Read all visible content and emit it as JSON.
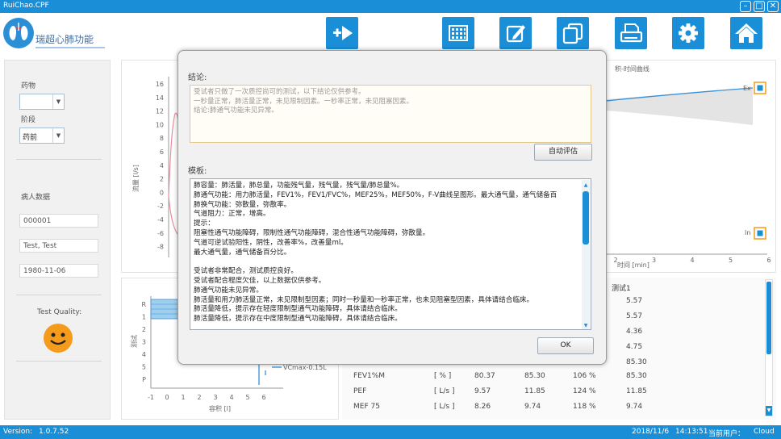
{
  "window": {
    "title": "RuiChao.CPF"
  },
  "header": {
    "logo_text": "瑞超心肺功能",
    "toolbar": [
      "new-test",
      "grid",
      "edit",
      "copy",
      "print",
      "settings",
      "home"
    ]
  },
  "left_panel": {
    "drug_label": "药物",
    "drug_value": "",
    "stage_label": "阶段",
    "stage_value": "药前",
    "patient_label": "病人数据",
    "patient_id": "000001",
    "patient_name": "Test, Test",
    "patient_dob": "1980-11-06",
    "quality_label": "Test Quality:",
    "quality_icon": "smiley-face-icon"
  },
  "charts": {
    "fv_ylabel": "流量 [l/s]",
    "fv_yticks": [
      "16",
      "14",
      "12",
      "10",
      "8",
      "6",
      "4",
      "2",
      "0",
      "-2",
      "-4",
      "-6",
      "-8"
    ],
    "vt_title": "积-时间曲线",
    "vt_xlabel": "时间 [min]",
    "vt_xticks": [
      "2",
      "3",
      "4",
      "5",
      "6"
    ],
    "vt_ex": "Ex",
    "vt_in": "In",
    "bar_ylabel": "测试",
    "bar_yticks": [
      "R",
      "1",
      "2",
      "3",
      "4",
      "5",
      "P"
    ],
    "bar_xlabel": "容积 [l]",
    "bar_xticks": [
      "-1",
      "0",
      "1",
      "2",
      "3",
      "4",
      "5",
      "6"
    ],
    "bar_legend": "VCmax-0.15L"
  },
  "results_table": {
    "col_test1": "测试1",
    "top_values": [
      "5.57",
      "5.57",
      "4.36",
      "4.75",
      "85.30"
    ],
    "rows": [
      {
        "param": "FEV1%M",
        "unit": "[ % ]",
        "v1": "80.37",
        "v2": "85.30",
        "pct": "106 %",
        "test1": "85.30"
      },
      {
        "param": "PEF",
        "unit": "[ L/s ]",
        "v1": "9.57",
        "v2": "11.85",
        "pct": "124 %",
        "test1": "11.85"
      },
      {
        "param": "MEF 75",
        "unit": "[ L/s ]",
        "v1": "8.26",
        "v2": "9.74",
        "pct": "118 %",
        "test1": "9.74"
      }
    ]
  },
  "modal": {
    "conclusion_label": "结论:",
    "conclusion_lines": [
      "受试者只做了一次质控尚可的测试，以下结论仅供参考。",
      "一秒量正常，肺活量正常，未见限制因素。一秒率正常，未见阻塞因素。",
      "结论:肺通气功能未见异常。"
    ],
    "auto_eval_button": "自动评估",
    "template_label": "模板:",
    "template_lines": [
      "肺容量：肺活量，肺总量，功能残气量，残气量，残气量/肺总量%。",
      "肺通气功能：用力肺活量，FEV1%，FEV1/FVC%，MEF25%，MEF50%，F-V曲线呈图形。最大通气量，通气储备百",
      "肺换气功能：弥散量，弥散率。",
      "气道阻力：正常，增高。",
      "提示：",
      "阻塞性通气功能障碍，限制性通气功能障碍，混合性通气功能障碍，弥散量。",
      "气道可逆试验阳性，阴性，改善率%，改善量ml。",
      "最大通气量，通气储备百分比。",
      "",
      "受试者非常配合，测试质控良好。",
      "受试者配合程度欠佳，以上数据仅供参考。",
      "肺通气功能未见异常。",
      "肺活量和用力肺活量正常，未见限制型因素；同时一秒量和一秒率正常，也未见阻塞型因素，具体请结合临床。",
      "肺活量降低，提示存在轻度限制型通气功能障碍，具体请结合临床。",
      "肺活量降低，提示存在中度限制型通气功能障碍，具体请结合临床。"
    ],
    "ok_button": "OK"
  },
  "status": {
    "version_label": "Version:",
    "version": "1.0.7.52",
    "date": "2018/11/6",
    "time": "14:13:51",
    "user_label": "当前用户：",
    "user": "Cloud"
  },
  "colors": {
    "accent": "#1a8fd8",
    "orange": "#f59b1c"
  }
}
